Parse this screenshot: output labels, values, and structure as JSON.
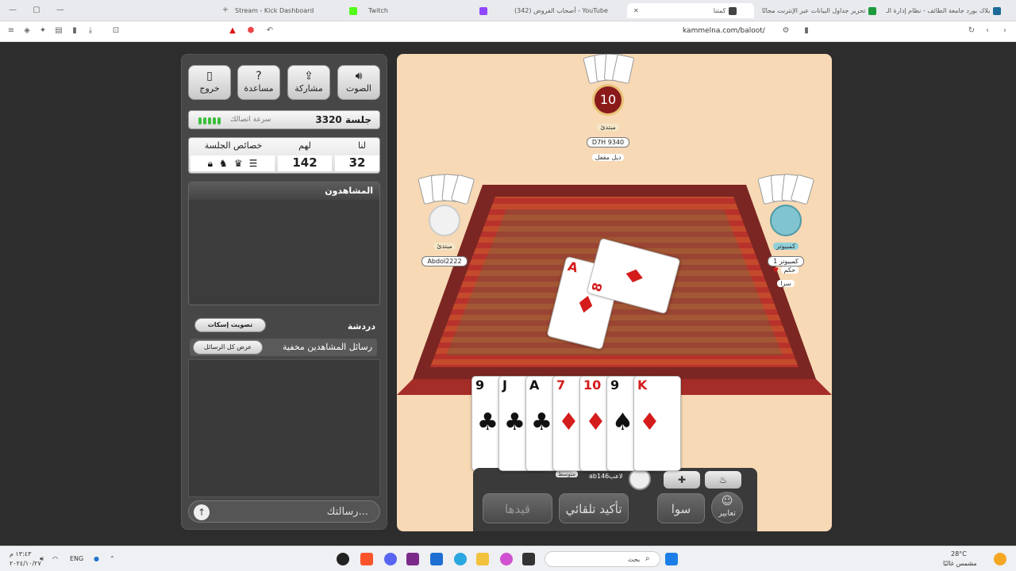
{
  "browser": {
    "tabs": [
      {
        "label": "Stream - Kick Dashboard",
        "color": "#e9eaee"
      },
      {
        "label": "Twitch",
        "color": "#53fc18"
      },
      {
        "label": "(342) أصحاب الفروض - YouTube",
        "color": "#9146ff"
      },
      {
        "label": "كمتنا",
        "color": "#444"
      },
      {
        "label": "تحرير جداول البيانات عبر الإنترنت مجانًا",
        "color": "#1d9a3c"
      },
      {
        "label": "بلاك بورد جامعة الطائف - نظام إدارة الـ",
        "color": "#1d6a9a"
      }
    ],
    "url": "kammelna.com/baloot/"
  },
  "panel": {
    "buttons": [
      {
        "label": "خروج",
        "icon": "door-icon"
      },
      {
        "label": "مساعدة",
        "icon": "question-icon"
      },
      {
        "label": "مشاركة",
        "icon": "share-icon"
      },
      {
        "label": "الصوت",
        "icon": "speaker-icon"
      }
    ],
    "session_title": "جلسة 3320",
    "speed_label": "سرعة اتصالك",
    "score": {
      "us_label": "لنا",
      "them_label": "لهم",
      "props_label": "خصائص الجلسة",
      "us": "32",
      "them": "142"
    },
    "spectators_title": "المشاهدون",
    "chat_title": "دردشة",
    "mute_vote": "تصويت إسكات",
    "spectator_msgs": "رسائل المشاهدين مخفية",
    "show_all": "عرض كل الرسائل",
    "message_placeholder": "رسالتك..."
  },
  "game": {
    "top_player": {
      "timer": "10",
      "rank": "مبتدئ",
      "name": "D7H 9340",
      "status": "ديل مقفل"
    },
    "left_player": {
      "rank": "مبتدئ",
      "name": "Abdol2222"
    },
    "right_player": {
      "rank": "كمبيوتر",
      "name": "كمبيوتر 1",
      "tag1": "حكم",
      "tag2": "سرا"
    },
    "table_cards": [
      {
        "rank": "A",
        "suit": "♦"
      },
      {
        "rank": "8",
        "suit": "♦"
      }
    ],
    "hand": [
      {
        "rank": "9",
        "suit": "♣",
        "color": "blk"
      },
      {
        "rank": "J",
        "suit": "♣",
        "color": "blk"
      },
      {
        "rank": "A",
        "suit": "♣",
        "color": "blk"
      },
      {
        "rank": "7",
        "suit": "♦",
        "color": "red"
      },
      {
        "rank": "10",
        "suit": "♦",
        "color": "red"
      },
      {
        "rank": "9",
        "suit": "♠",
        "color": "blk"
      },
      {
        "rank": "K",
        "suit": "♦",
        "color": "red"
      }
    ],
    "my_name": "ab146لاعب",
    "my_rank": "متوسط",
    "controls": {
      "emotes": "تعابير",
      "sawa": "سوا",
      "auto_confirm": "تأكيد تلقائي",
      "qaidha": "قيدها"
    }
  },
  "taskbar": {
    "search": "بحث",
    "lang": "ENG",
    "time": "١٣:٤٣ م",
    "date": "٢٠٢٤/١٠/٢٧",
    "weather_temp": "28°C",
    "weather_desc": "مشمس غالبًا"
  }
}
